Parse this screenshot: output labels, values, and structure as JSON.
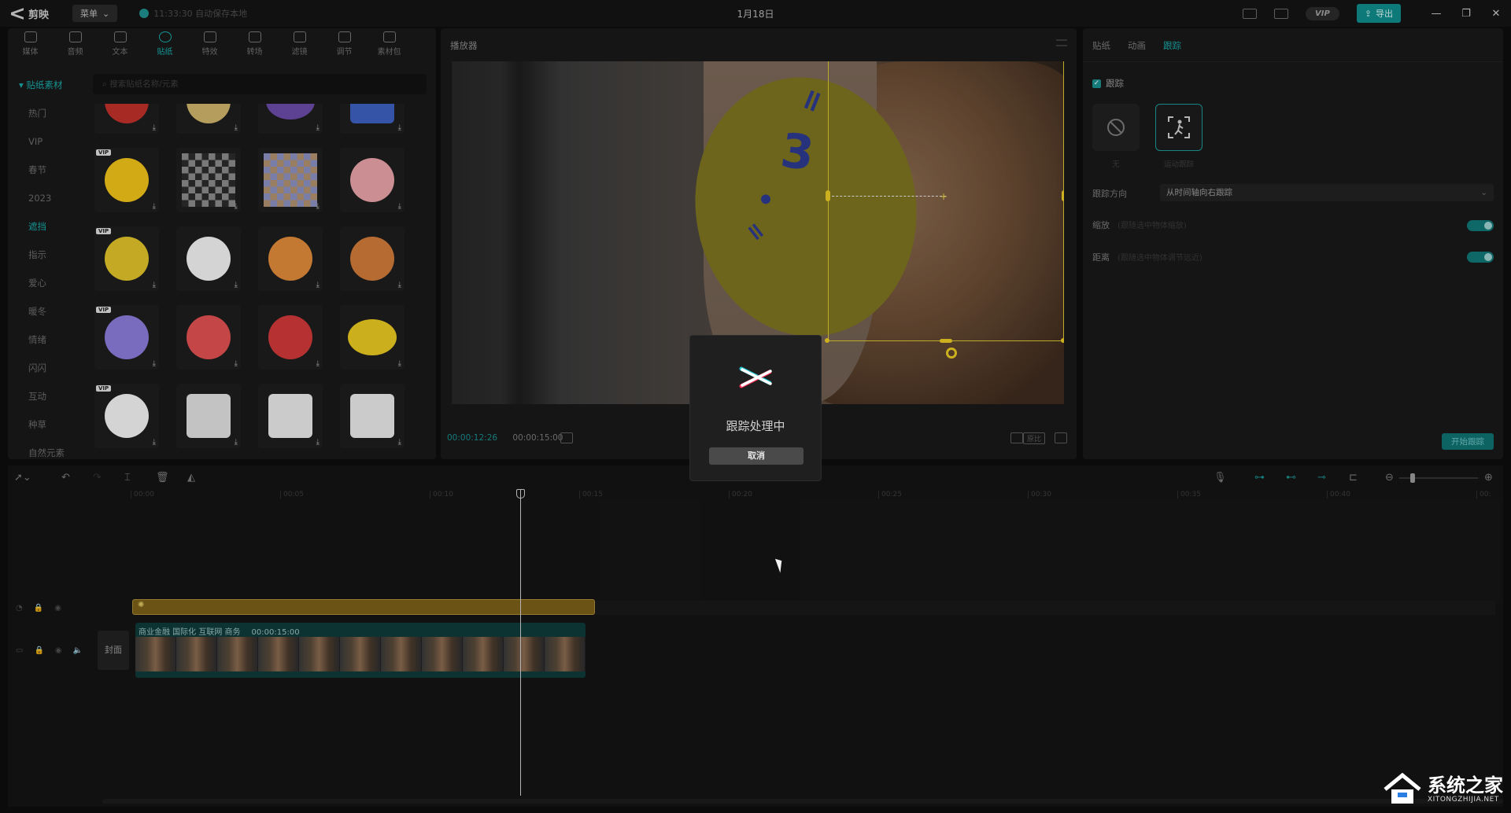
{
  "titlebar": {
    "app_name": "剪映",
    "menu_label": "菜单",
    "save_status": "11:33:30 自动保存本地",
    "window_title": "1月18日",
    "vip_label": "VIP",
    "export_label": "导出"
  },
  "tool_tabs": [
    {
      "label": "媒体",
      "icon": "media-icon"
    },
    {
      "label": "音频",
      "icon": "audio-icon"
    },
    {
      "label": "文本",
      "icon": "text-icon"
    },
    {
      "label": "贴纸",
      "icon": "sticker-icon",
      "active": true
    },
    {
      "label": "特效",
      "icon": "effects-icon"
    },
    {
      "label": "转场",
      "icon": "transition-icon"
    },
    {
      "label": "滤镜",
      "icon": "filter-icon"
    },
    {
      "label": "调节",
      "icon": "adjust-icon"
    },
    {
      "label": "素材包",
      "icon": "asset-pack-icon"
    }
  ],
  "sidebar": {
    "header": "贴纸素材",
    "categories": [
      "热门",
      "VIP",
      "春节",
      "2023",
      "遮挡",
      "指示",
      "爱心",
      "暖冬",
      "情绪",
      "闪闪",
      "互动",
      "种草",
      "自然元素"
    ],
    "active_category": "遮挡"
  },
  "search": {
    "placeholder": "搜索贴纸名称/元素"
  },
  "sticker_vip_label": "VIP",
  "player": {
    "title": "播放器",
    "time_current": "00:00:12:26",
    "time_total": "00:00:15:00",
    "ratio_label": "原比"
  },
  "right_panel": {
    "tabs": [
      "贴纸",
      "动画",
      "跟踪"
    ],
    "active_tab": "跟踪",
    "tracking_checkbox": "跟踪",
    "mode_none": "无",
    "mode_motion": "运动跟踪",
    "direction_label": "跟踪方向",
    "direction_value": "从时间轴向右跟踪",
    "scale_label": "缩放",
    "scale_hint": "(跟随选中物体缩放)",
    "distance_label": "距离",
    "distance_hint": "(跟随选中物体调节远近)",
    "start_button": "开始跟踪"
  },
  "timeline": {
    "ruler": [
      "00:00",
      "00:05",
      "00:10",
      "00:15",
      "00:20",
      "00:25",
      "00:30",
      "00:35",
      "00:40",
      "00:"
    ],
    "cover_label": "封面",
    "video_clip_label": "商业金融 国际化 互联网 商务",
    "video_clip_duration": "00:00:15:00"
  },
  "modal": {
    "message": "跟踪处理中",
    "cancel_label": "取消"
  },
  "watermark": {
    "title": "系统之家",
    "url": "XITONGZHIJIA.NET"
  },
  "colors": {
    "accent": "#1aa7a7",
    "tracking_box": "#d8c22e",
    "sticker_clip": "#7a5f1a"
  }
}
